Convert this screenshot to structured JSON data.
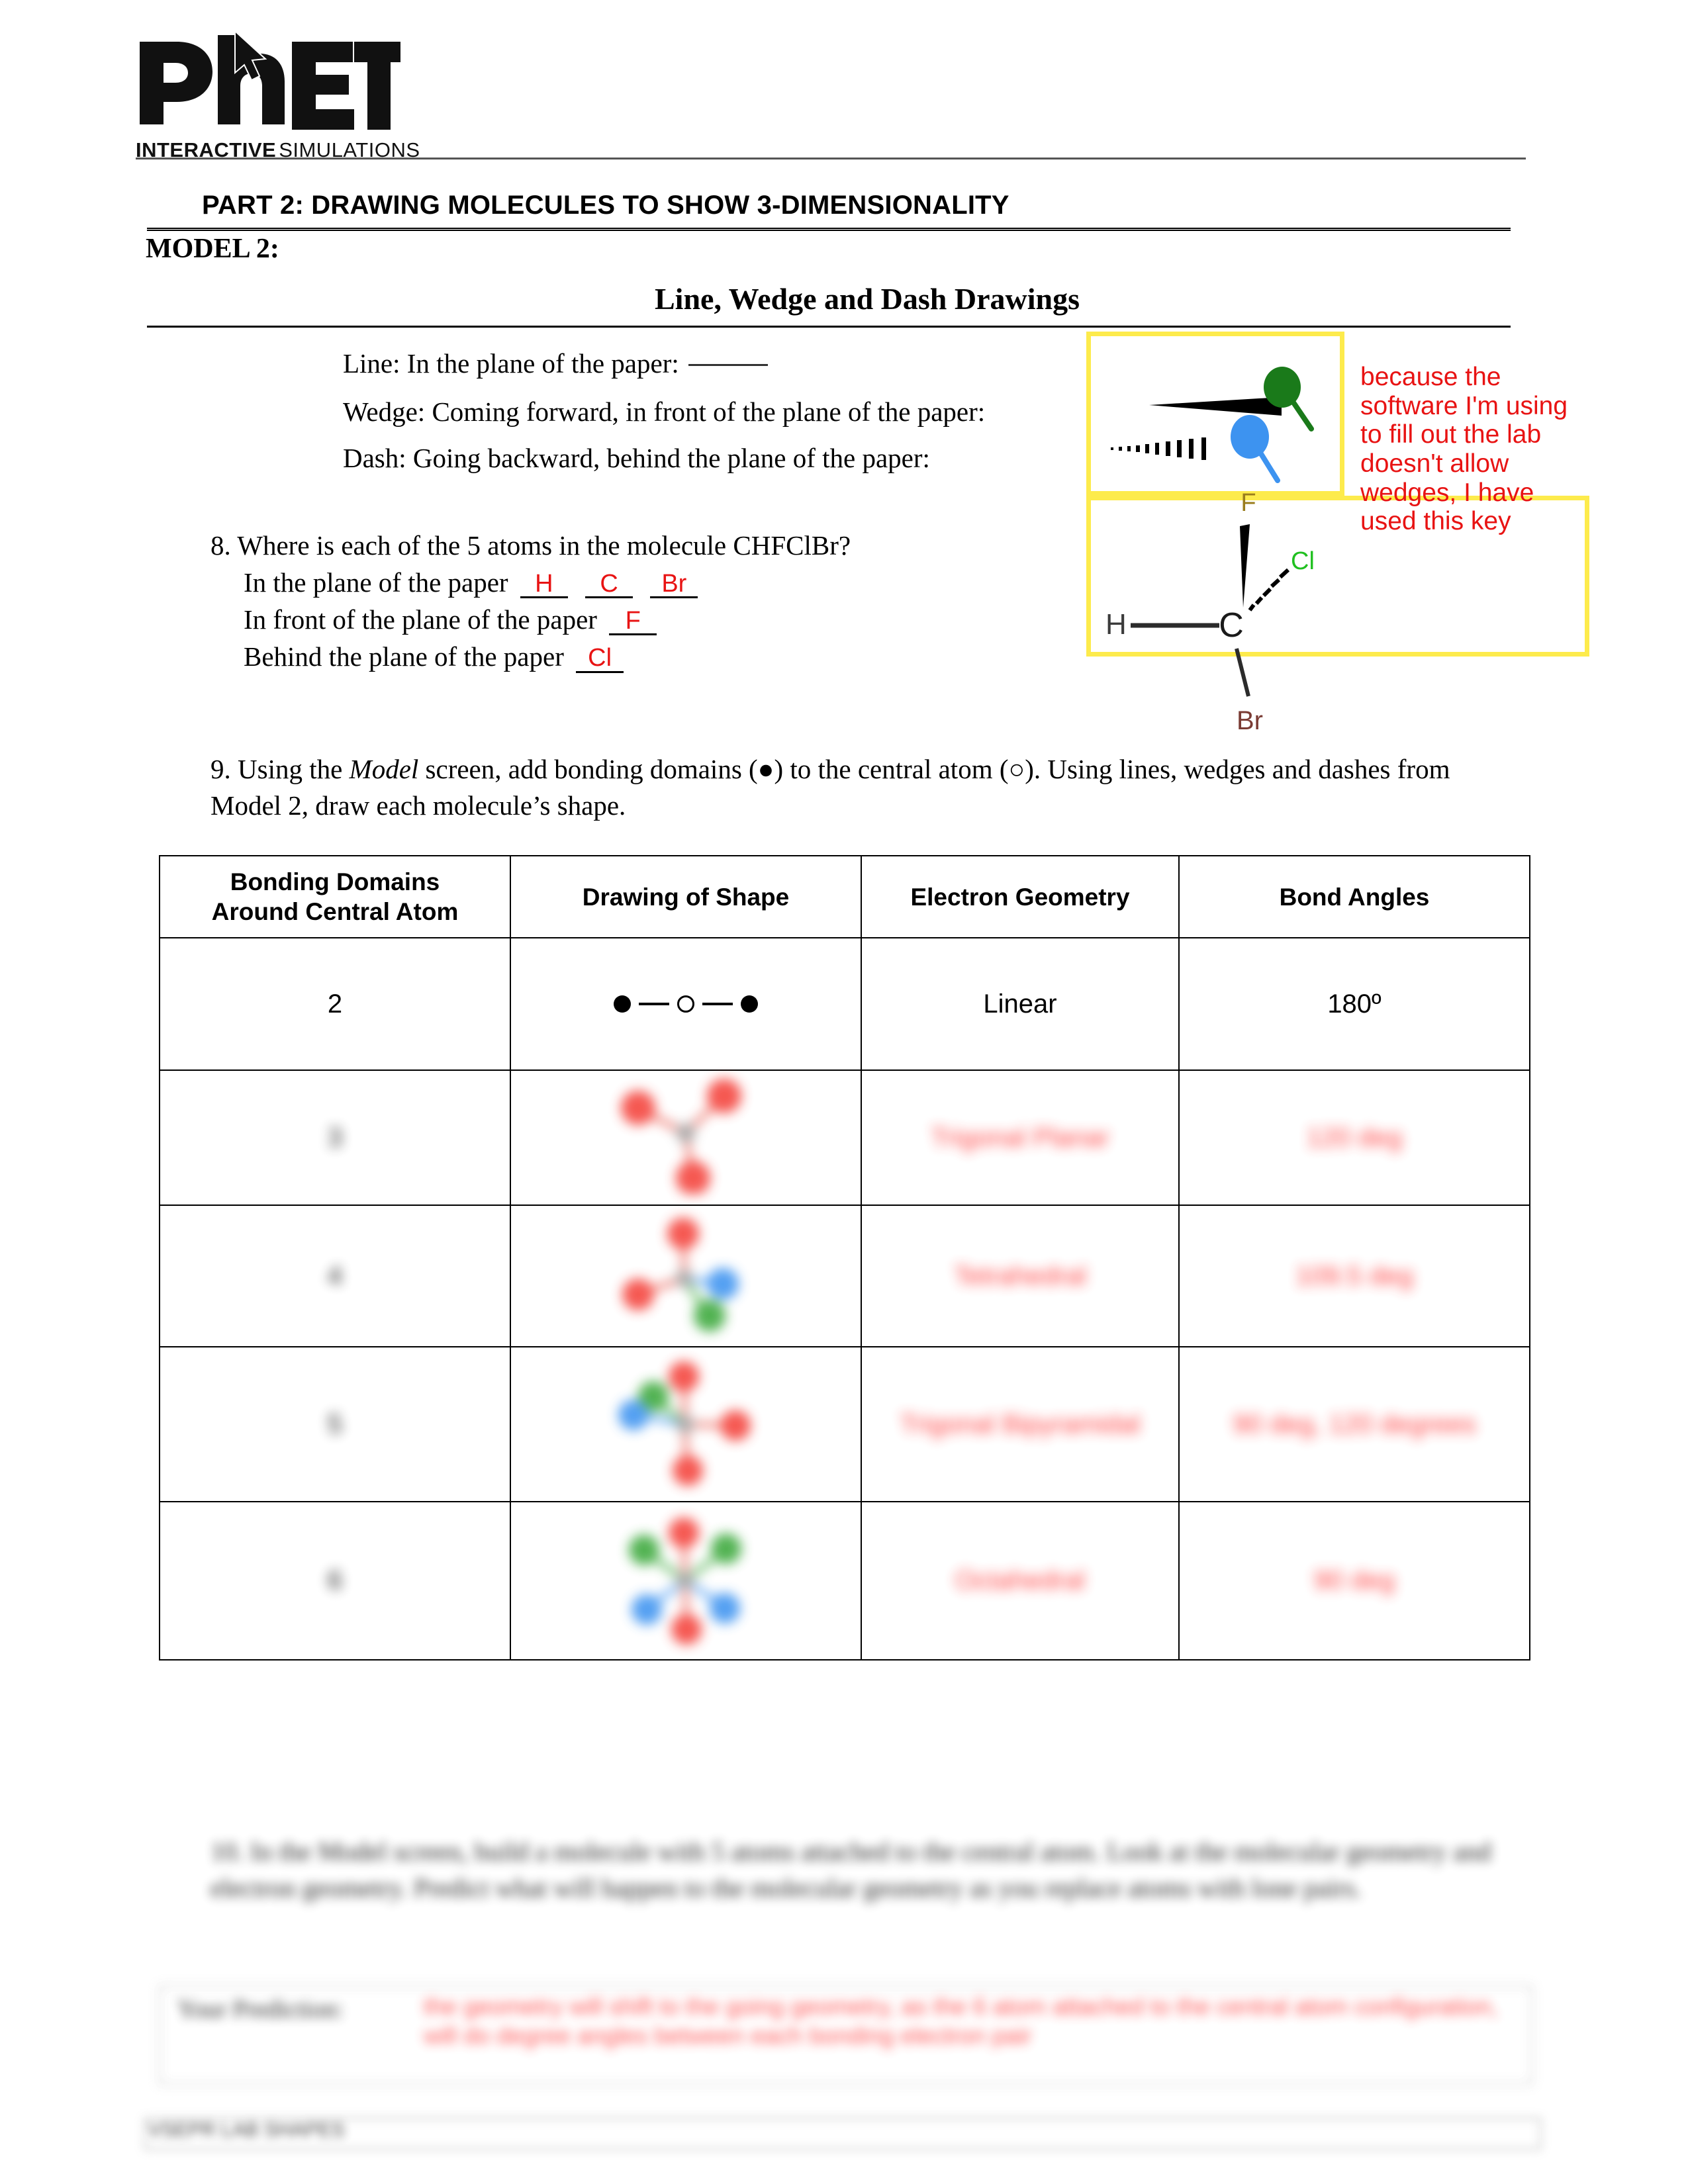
{
  "logo": {
    "wordmark": "PhET",
    "tagline_bold": "INTERACTIVE",
    "tagline_light": "SIMULATIONS"
  },
  "headings": {
    "part_title": "PART 2: DRAWING MOLECULES TO SHOW 3-DIMENSIONALITY",
    "model_label": "MODEL 2:",
    "model_subtitle": "Line, Wedge and Dash Drawings"
  },
  "definitions": {
    "line": "Line: In the plane of the paper:",
    "wedge": "Wedge: Coming forward, in front of the plane of the paper:",
    "dash": "Dash: Going backward, behind the plane of the paper:"
  },
  "key_annotation": "because the software I'm using to fill out the lab doesn't allow wedges, I have used this key",
  "key_colors": {
    "wedge_pin": "#1a7a1a",
    "dash_pin": "#3d93f0",
    "box_border": "#fdeb4c",
    "annotation_red": "#e81313"
  },
  "molecule": {
    "formula": "CHFClBr",
    "center": "C",
    "atoms": [
      {
        "label": "H",
        "bond": "line",
        "color": "#3b3b3b"
      },
      {
        "label": "F",
        "bond": "wedge",
        "color": "#9a7d1d"
      },
      {
        "label": "Cl",
        "bond": "dash",
        "color": "#20c020"
      },
      {
        "label": "Br",
        "bond": "line",
        "color": "#7a3b34"
      }
    ]
  },
  "q8": {
    "number": "8.",
    "prompt": "Where is each of the 5 atoms in the molecule CHFClBr?",
    "rows": [
      {
        "label": "In the plane of the paper",
        "answers": [
          "H",
          "C",
          "Br"
        ]
      },
      {
        "label": "In front of the plane of the paper",
        "answers": [
          "F"
        ]
      },
      {
        "label": "Behind the plane of the paper",
        "answers": [
          "Cl"
        ]
      }
    ]
  },
  "q9": {
    "number": "9.",
    "text_part1": "Using the ",
    "text_em": "Model",
    "text_part2": " screen, add bonding domains (●) to the central atom (○). Using lines, wedges and dashes from Model 2, draw each molecule’s shape."
  },
  "table": {
    "headers": [
      "Bonding Domains Around Central Atom",
      "Drawing of Shape",
      "Electron Geometry",
      "Bond Angles"
    ],
    "header_line1": [
      "Bonding Domains",
      "Drawing of Shape",
      "Electron Geometry",
      "Bond Angles"
    ],
    "header_line2": [
      "Around Central Atom",
      "",
      "",
      ""
    ],
    "rows": [
      {
        "domains": "2",
        "drawing": "linear-diagram",
        "geometry": "Linear",
        "angles": "180º",
        "blurred": false
      },
      {
        "domains": "3",
        "drawing": "trigonal-planar-model",
        "geometry": "Trigonal Planar",
        "angles": "120 deg",
        "blurred": true
      },
      {
        "domains": "4",
        "drawing": "tetrahedral-model",
        "geometry": "Tetrahedral",
        "angles": "109.5 deg",
        "blurred": true
      },
      {
        "domains": "5",
        "drawing": "trigonal-bipyramidal-model",
        "geometry": "Trigonal Bipyramidal",
        "angles": "90 deg, 120 degrees",
        "blurred": true
      },
      {
        "domains": "6",
        "drawing": "octahedral-model",
        "geometry": "Octahedral",
        "angles": "90 deg",
        "blurred": true
      }
    ]
  },
  "q10": {
    "number": "10.",
    "text": "In the Model screen, build a molecule with 5 atoms attached to the central atom. Look at the molecular geometry and electron geometry. Predict what will happen to the molecular geometry as you replace atoms with lone pairs.",
    "prediction_label": "Your Prediction:",
    "prediction_answer": "the geometry will shift to the going geometry, as the 6 atom attached to the central atom configuration, will do degree angles between each bonding electron pair"
  },
  "footer": {
    "left": "VSEPR LAB SHAPES"
  }
}
